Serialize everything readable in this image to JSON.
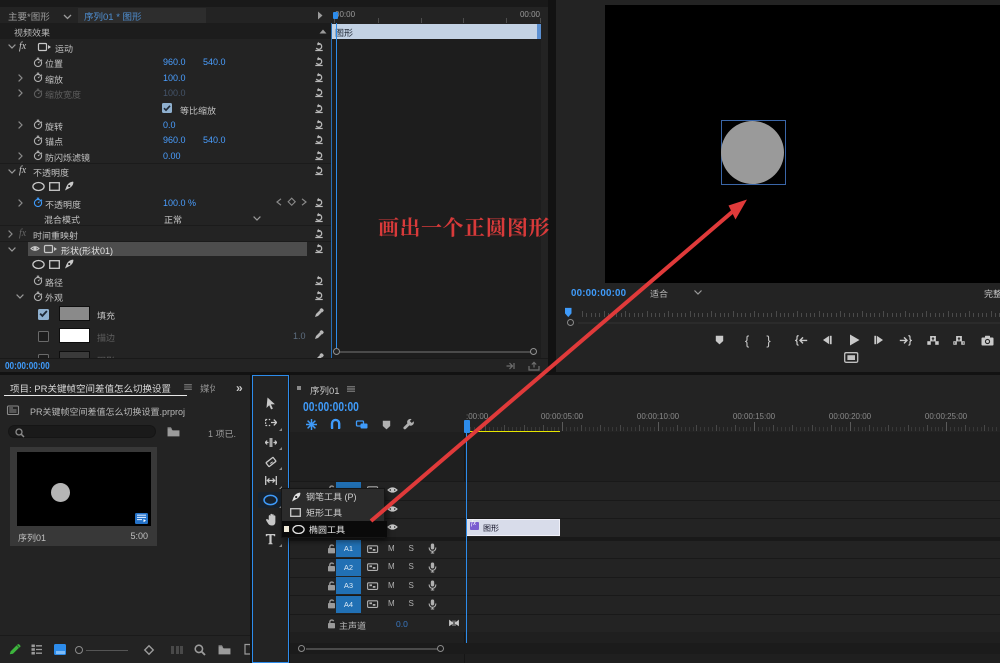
{
  "colors": {
    "accent_blue": "#2d8ceb",
    "value_blue": "#4a9eff",
    "timecode_blue": "#3f9bfa",
    "annotation_red": "#e03a3a",
    "clip_selected": "#d8dcea",
    "track_badge_blue": "#2170b4",
    "yellow_bar": "#e6e600",
    "panel_bg": "#232323"
  },
  "effect_controls": {
    "tab_master": "主要*图形",
    "tab_clip": "序列01 * 图形",
    "section_header": "视频效果",
    "rows": [
      {
        "label": "运动"
      },
      {
        "label": "位置",
        "v1": "960.0",
        "v2": "540.0"
      },
      {
        "label": "缩放",
        "v1": "100.0"
      },
      {
        "label": "缩放宽度",
        "v1": "100.0"
      },
      {
        "label": "等比缩放"
      },
      {
        "label": "旋转",
        "v1": "0.0"
      },
      {
        "label": "锚点",
        "v1": "960.0",
        "v2": "540.0"
      },
      {
        "label": "防闪烁滤镜",
        "v1": "0.00"
      },
      {
        "label": "不透明度"
      },
      {
        "label": "不透明度",
        "v1": "100.0 %"
      },
      {
        "label": "混合模式",
        "v1": "正常"
      },
      {
        "label": "时间重映射"
      },
      {
        "label": "形状(形状01)"
      },
      {
        "label": "路径"
      },
      {
        "label": "外观"
      },
      {
        "label": "填充"
      },
      {
        "label": "描边",
        "v1": "1.0"
      },
      {
        "label": "阴影"
      }
    ],
    "mini_ruler_left": "00:00",
    "mini_ruler_right": "00:00",
    "mini_clip": "图形",
    "status_timecode": "00:00:00:00"
  },
  "program_monitor": {
    "timecode": "00:00:00:00",
    "zoom_select": "适合",
    "quality_select": "完整",
    "transport": [
      "add-marker",
      "mark-in",
      "mark-out",
      "go-to-in",
      "step-back",
      "play",
      "step-forward",
      "go-to-out",
      "lift",
      "extract",
      "export-frame"
    ]
  },
  "annotation": {
    "text": "画出一个正圆图形"
  },
  "project_panel": {
    "tab": "项目: PR关键帧空间差值怎么切换设置",
    "tab_next_partial": "媒体",
    "overflow": "»",
    "project_file": "PR关键帧空间差值怎么切换设置.prproj",
    "items_status": "1 项已.",
    "clip_name": "序列01",
    "clip_duration": "5:00"
  },
  "tools": [
    "selection",
    "track-select-forward",
    "ripple-edit",
    "razor",
    "slip",
    "ellipse",
    "hand",
    "type"
  ],
  "tool_popup": {
    "items": [
      {
        "label": "钢笔工具 (P)"
      },
      {
        "label": "矩形工具"
      },
      {
        "label": "椭圆工具",
        "selected": true
      }
    ]
  },
  "timeline": {
    "tab": "序列01",
    "timecode": "00:00:00:00",
    "ruler_labels": [
      ":00:00",
      "00:00:05:00",
      "00:00:10:00",
      "00:00:15:00",
      "00:00:20:00",
      "00:00:25:00"
    ],
    "clip_name": "图形",
    "audio_tracks": [
      "A1",
      "A2",
      "A3",
      "A4"
    ],
    "master_track": "主声道",
    "master_level": "0.0",
    "track_buttons": {
      "mute": "M",
      "solo": "S"
    }
  }
}
